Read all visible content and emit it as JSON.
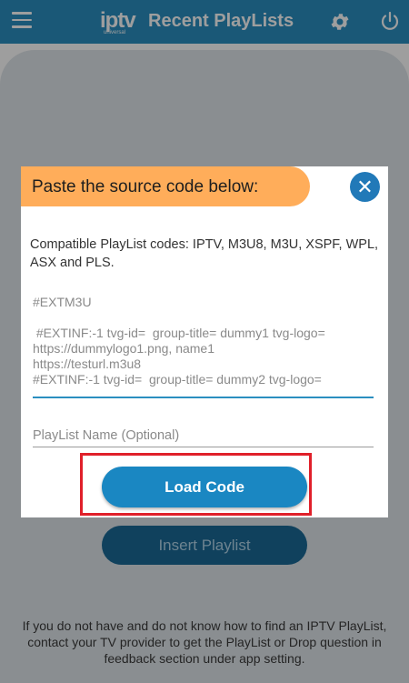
{
  "app_bar": {
    "logo_main": "iptv",
    "logo_sub": "universal",
    "title": "Recent PlayLists",
    "icons": [
      "menu-icon",
      "gear-icon",
      "power-icon"
    ],
    "color": "#2b8fc0"
  },
  "background": {
    "insert_button_label": "Insert Playlist",
    "help_text": "If you do not have and do not know how to find an IPTV PlayList, contact your TV provider to get the PlayList or Drop question in feedback section under app setting."
  },
  "dialog": {
    "title": "Paste the source code below:",
    "close_icon": "close-icon",
    "header_color": "#ffad5a",
    "compat_text": "Compatible PlayList codes: IPTV, M3U8, M3U, XSPF, WPL, ASX and PLS.",
    "code_lines": [
      "#EXTM3U",
      "",
      " #EXTINF:-1 tvg-id=  group-title= dummy1 tvg-logo= https://dummylogo1.png, name1",
      "https://testurl.m3u8",
      "#EXTINF:-1 tvg-id=  group-title= dummy2 tvg-logo="
    ],
    "playlist_name_placeholder": "PlayList Name (Optional)",
    "load_button_label": "Load Code",
    "highlight_color": "#e0202a"
  }
}
